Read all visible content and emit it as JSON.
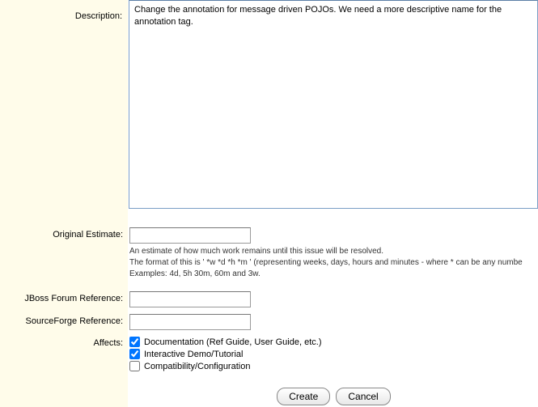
{
  "labels": {
    "description": "Description:",
    "original_estimate": "Original Estimate:",
    "jboss_forum": "JBoss Forum Reference:",
    "sourceforge": "SourceForge Reference:",
    "affects": "Affects:"
  },
  "description": {
    "value": "Change the annotation for message driven POJOs. We need a more descriptive name for the annotation tag."
  },
  "original_estimate": {
    "value": "",
    "hint_line1": "An estimate of how much work remains until this issue will be resolved.",
    "hint_line2": "The format of this is ' *w *d *h *m ' (representing weeks, days, hours and minutes - where * can be any numbe",
    "hint_line3": "Examples: 4d, 5h 30m, 60m and 3w."
  },
  "jboss_forum": {
    "value": ""
  },
  "sourceforge": {
    "value": ""
  },
  "affects": {
    "options": [
      {
        "label": "Documentation (Ref Guide, User Guide, etc.)",
        "checked": true
      },
      {
        "label": "Interactive Demo/Tutorial",
        "checked": true
      },
      {
        "label": "Compatibility/Configuration",
        "checked": false
      }
    ]
  },
  "buttons": {
    "create": "Create",
    "cancel": "Cancel"
  }
}
